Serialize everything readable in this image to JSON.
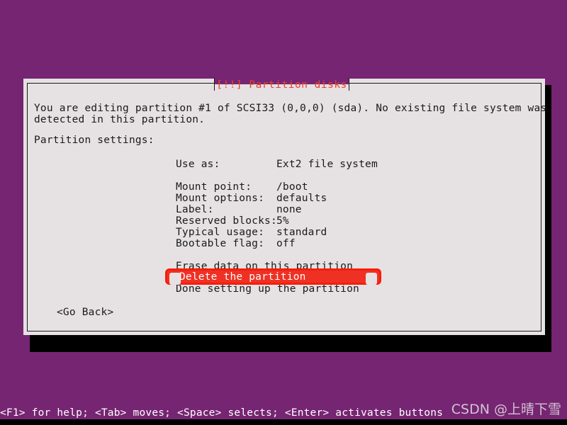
{
  "screen": {
    "background_color": "#762572",
    "shadow_color": "#000000"
  },
  "dialog": {
    "title": "[!!] Partition disks",
    "title_color": "#e8412c",
    "background_color": "#e6e2e4",
    "border_color": "#1a1a1a",
    "intro_text": "You are editing partition #1 of SCSI33 (0,0,0) (sda). No existing file system was\ndetected in this partition.",
    "settings_heading": "Partition settings:",
    "settings": [
      {
        "key": "Use as:",
        "value": "Ext2 file system"
      },
      {
        "key": "",
        "value": ""
      },
      {
        "key": "Mount point:",
        "value": "/boot"
      },
      {
        "key": "Mount options:",
        "value": "defaults"
      },
      {
        "key": "Label:",
        "value": "none"
      },
      {
        "key": "Reserved blocks:",
        "value": "5%"
      },
      {
        "key": "Typical usage:",
        "value": "standard"
      },
      {
        "key": "Bootable flag:",
        "value": "off"
      }
    ],
    "actions": [
      {
        "label": "Erase data on this partition",
        "selected": false
      },
      {
        "label": "Delete the partition",
        "selected": true
      },
      {
        "label": "Done setting up the partition",
        "selected": false
      }
    ],
    "go_back_button": "<Go Back>"
  },
  "annotation": {
    "target_label": "Delete the partition",
    "box_color": "#ef3124",
    "border_color": "#f71d0a"
  },
  "statusbar": {
    "text": "<F1> for help; <Tab> moves; <Space> selects; <Enter> activates buttons",
    "text_color": "#ffffff"
  },
  "watermark": {
    "text": "CSDN @上晴下雪"
  }
}
